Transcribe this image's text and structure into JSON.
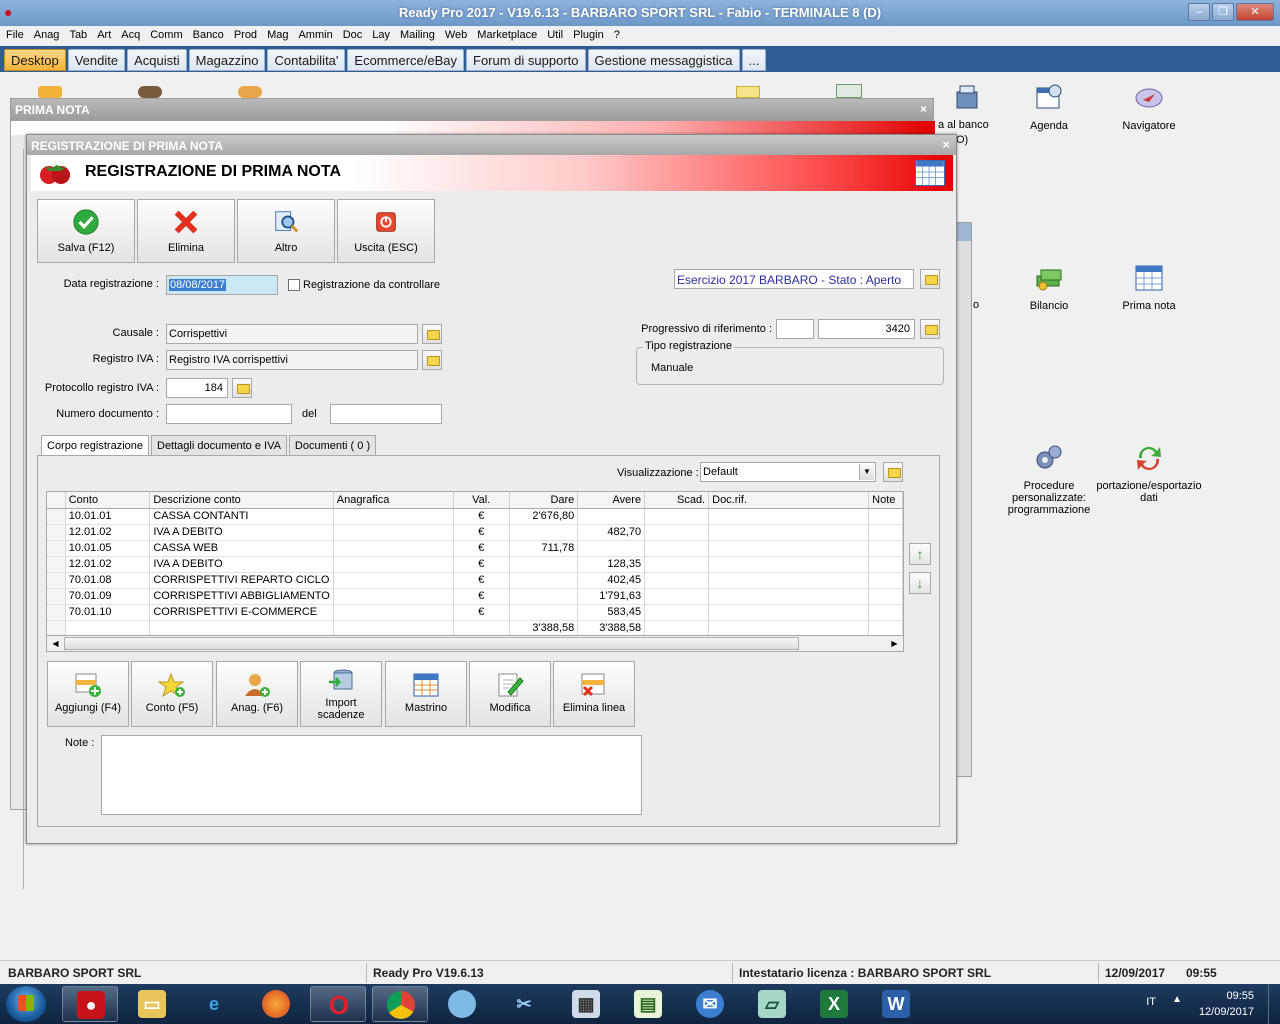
{
  "window": {
    "title": "Ready Pro 2017 - V19.6.13 - BARBARO SPORT SRL - Fabio - TERMINALE 8 (D)"
  },
  "menu": [
    "File",
    "Anag",
    "Tab",
    "Art",
    "Acq",
    "Comm",
    "Banco",
    "Prod",
    "Mag",
    "Ammin",
    "Doc",
    "Lay",
    "Mailing",
    "Web",
    "Marketplace",
    "Util",
    "Plugin",
    "?"
  ],
  "tabs": [
    "Desktop",
    "Vendite",
    "Acquisti",
    "Magazzino",
    "Contabilita'",
    "Ecommerce/eBay",
    "Forum di supporto",
    "Gestione messaggistica",
    "..."
  ],
  "desktop_icons": [
    {
      "label": "a al banco"
    },
    {
      "label": "O)"
    },
    {
      "label": "Agenda"
    },
    {
      "label": "Navigatore"
    },
    {
      "label": "o"
    },
    {
      "label": "Bilancio"
    },
    {
      "label": "Prima nota"
    },
    {
      "label": "Procedure personalizzate: programmazione"
    },
    {
      "label": "portazione/esportazio dati"
    }
  ],
  "bg_window": {
    "title": "PRIMA NOTA",
    "close": "×"
  },
  "dialog": {
    "title": "REGISTRAZIONE DI PRIMA NOTA",
    "close": "×",
    "header": "REGISTRAZIONE DI PRIMA NOTA",
    "toolbar": {
      "save": "Salva (F12)",
      "delete": "Elimina",
      "other": "Altro",
      "exit": "Uscita (ESC)"
    },
    "fields": {
      "data_registrazione_label": "Data registrazione :",
      "data_registrazione": "08/08/2017",
      "da_controllare_label": "Registrazione da controllare",
      "esercizio": "Esercizio 2017 BARBARO - Stato : Aperto",
      "causale_label": "Causale :",
      "causale": "Corrispettivi",
      "registro_iva_label": "Registro IVA :",
      "registro_iva": "Registro IVA corrispettivi",
      "protocollo_label": "Protocollo registro IVA :",
      "protocollo": "184",
      "numero_doc_label": "Numero documento :",
      "numero_doc": "",
      "del_label": "del",
      "del": "",
      "progressivo_label": "Progressivo di riferimento :",
      "progressivo_prefix": "",
      "progressivo": "3420",
      "tipo_label": "Tipo registrazione",
      "tipo": "Manuale"
    },
    "inner_tabs": [
      "Corpo registrazione",
      "Dettagli documento e IVA",
      "Documenti ( 0 )"
    ],
    "visualizzazione_label": "Visualizzazione :",
    "visualizzazione": "Default",
    "grid": {
      "columns": [
        "Conto",
        "Descrizione conto",
        "Anagrafica",
        "Val.",
        "Dare",
        "Avere",
        "Scad.",
        "Doc.rif.",
        "Note"
      ],
      "rows": [
        [
          "10.01.01",
          "CASSA CONTANTI",
          "",
          "€",
          "2'676,80",
          "",
          "",
          "",
          ""
        ],
        [
          "12.01.02",
          "IVA A DEBITO",
          "",
          "€",
          "",
          "482,70",
          "",
          "",
          ""
        ],
        [
          "10.01.05",
          "CASSA WEB",
          "",
          "€",
          "711,78",
          "",
          "",
          "",
          ""
        ],
        [
          "12.01.02",
          "IVA A DEBITO",
          "",
          "€",
          "",
          "128,35",
          "",
          "",
          ""
        ],
        [
          "70.01.08",
          "CORRISPETTIVI REPARTO CICLO",
          "",
          "€",
          "",
          "402,45",
          "",
          "",
          ""
        ],
        [
          "70.01.09",
          "CORRISPETTIVI ABBIGLIAMENTO",
          "",
          "€",
          "",
          "1'791,63",
          "",
          "",
          ""
        ],
        [
          "70.01.10",
          "CORRISPETTIVI E-COMMERCE",
          "",
          "€",
          "",
          "583,45",
          "",
          "",
          ""
        ]
      ],
      "totals": {
        "dare": "3'388,58",
        "avere": "3'388,58"
      }
    },
    "bottom_buttons": [
      "Aggiungi (F4)",
      "Conto (F5)",
      "Anag. (F6)",
      "Import scadenze",
      "Mastrino",
      "Modifica",
      "Elimina linea"
    ],
    "note_label": "Note :"
  },
  "statusbar": {
    "company": "BARBARO SPORT SRL",
    "version": "Ready Pro V19.6.13",
    "license": "Intestatario licenza : BARBARO SPORT SRL",
    "date": "12/09/2017",
    "time": "09:55"
  },
  "taskbar": {
    "lang": "IT",
    "clock_time": "09:55",
    "clock_date": "12/09/2017"
  }
}
